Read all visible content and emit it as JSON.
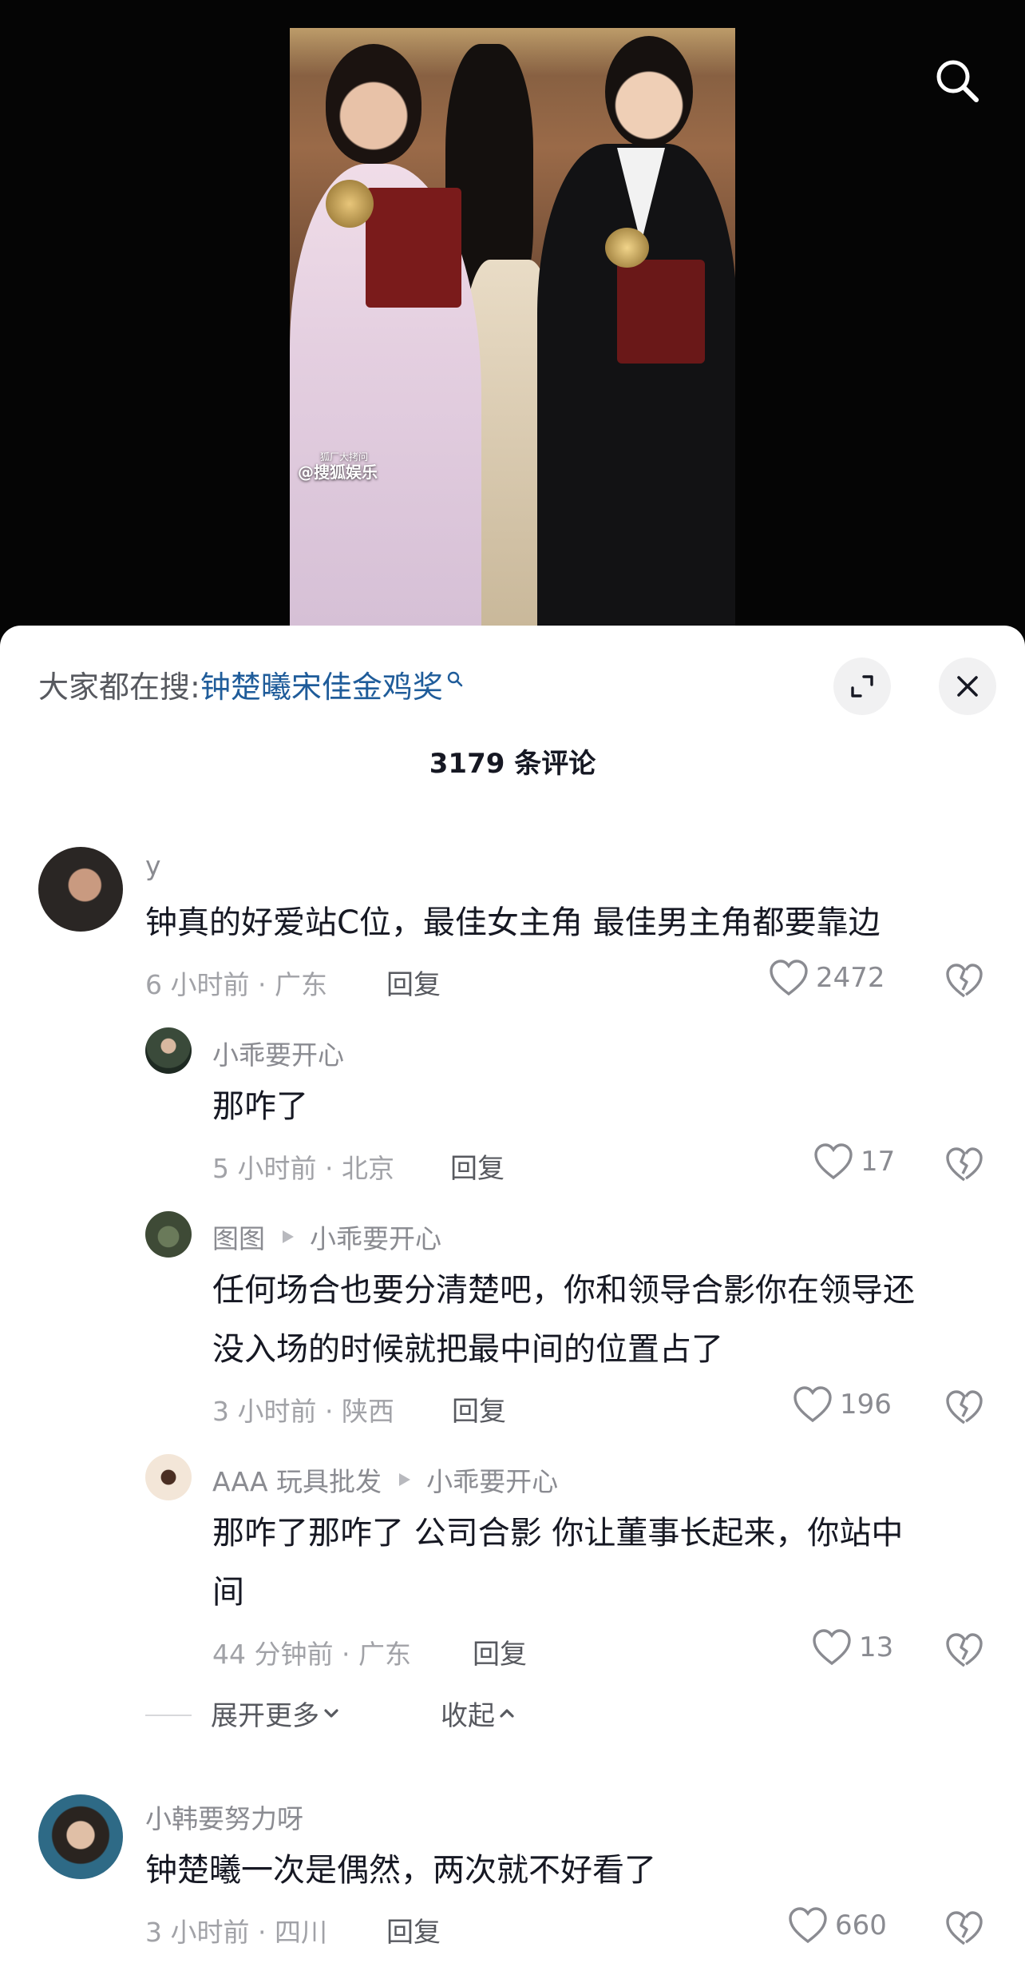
{
  "header": {
    "search_prefix": "大家都在搜:",
    "search_keyword": "钟楚曦宋佳金鸡奖",
    "comment_count": "3179 条评论"
  },
  "video": {
    "watermark_small": "狐厂大拷问",
    "watermark": "@搜狐娱乐"
  },
  "comments": [
    {
      "username": "y",
      "text_lines": [
        "钟真的好爱站C位，最佳女主角 最佳男主角都要靠边"
      ],
      "meta": "6 小时前 · 广东",
      "reply_label": "回复",
      "likes": "2472"
    },
    {
      "username": "小乖要开心",
      "text_lines": [
        "那咋了"
      ],
      "meta": "5 小时前 · 北京",
      "reply_label": "回复",
      "likes": "17"
    },
    {
      "username": "图图",
      "reply_to": "小乖要开心",
      "text_lines": [
        "任何场合也要分清楚吧，你和领导合影你在领导还",
        "没入场的时候就把最中间的位置占了"
      ],
      "meta": "3 小时前 · 陕西",
      "reply_label": "回复",
      "likes": "196"
    },
    {
      "username": "AAA 玩具批发",
      "reply_to": "小乖要开心",
      "text_lines": [
        "那咋了那咋了  公司合影  你让董事长起来，你站中",
        "间"
      ],
      "meta": "44 分钟前 · 广东",
      "reply_label": "回复",
      "likes": "13"
    },
    {
      "username": "小韩要努力呀",
      "text_lines": [
        "钟楚曦一次是偶然，两次就不好看了"
      ],
      "meta": "3 小时前 · 四川",
      "reply_label": "回复",
      "likes": "660"
    }
  ],
  "thread_controls": {
    "expand_more": "展开更多",
    "collapse": "收起"
  },
  "colors": {
    "keyword": "#1f5c9a",
    "text": "#161823",
    "meta": "#a1a2a7",
    "username": "#8a8b91"
  }
}
